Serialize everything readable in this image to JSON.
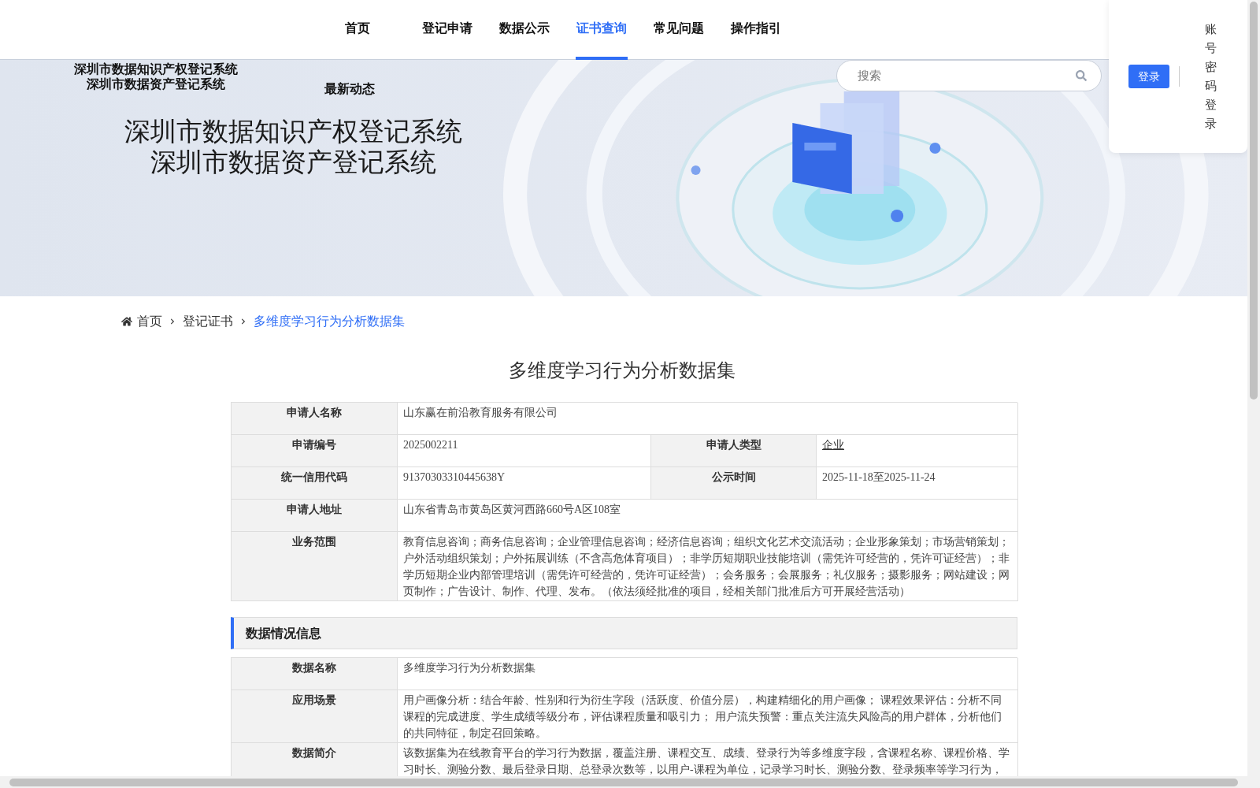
{
  "nav": [
    {
      "label": "首页",
      "selected": false
    },
    {
      "label": "登记申请",
      "selected": false
    },
    {
      "label": "数据公示",
      "selected": false
    },
    {
      "label": "证书查询",
      "selected": true
    },
    {
      "label": "常见问题",
      "selected": false
    },
    {
      "label": "操作指引",
      "selected": false
    }
  ],
  "header": {
    "small_titles": [
      "深圳市数据知识产权登记系统",
      "深圳市数据资产登记系统"
    ],
    "news": "最新动态",
    "search": {
      "placeholder": "搜索"
    }
  },
  "login": {
    "button": "登录",
    "password_login": "账号密码登录"
  },
  "banner": {
    "titles": [
      "深圳市数据知识产权登记系统",
      "深圳市数据资产登记系统"
    ]
  },
  "breadcrumb": [
    "首页",
    "登记证书",
    "多维度学习行为分析数据集"
  ],
  "page_title": "多维度学习行为分析数据集",
  "applicant_table": [
    [
      {
        "label": "申请人名称",
        "value": "山东赢在前沿教育服务有限公司"
      }
    ],
    [
      {
        "label": "申请编号",
        "value": "2025002211"
      },
      {
        "label": "申请人类型",
        "value": "企业",
        "link": true
      }
    ],
    [
      {
        "label": "统一信用代码",
        "value": "91370303310445638Y"
      },
      {
        "label": "公示时间",
        "value": "2025-11-18至2025-11-24"
      }
    ],
    [
      {
        "label": "申请人地址",
        "value": "山东省青岛市黄岛区黄河西路660号A区108室"
      }
    ],
    [
      {
        "label": "业务范围",
        "value": "教育信息咨询；商务信息咨询；企业管理信息咨询；经济信息咨询；组织文化艺术交流活动；企业形象策划；市场营销策划；户外活动组织策划；户外拓展训练（不含高危体育项目）；非学历短期职业技能培训（需凭许可经营的，凭许可证经营）；非学历短期企业内部管理培训（需凭许可经营的，凭许可证经营）；会务服务；会展服务；礼仪服务；摄影服务；网站建设；网页制作；广告设计、制作、代理、发布。（依法须经批准的项目，经相关部门批准后方可开展经营活动）"
      }
    ]
  ],
  "data_section": {
    "title": "数据情况信息",
    "rows": [
      {
        "label": "数据名称",
        "value": "多维度学习行为分析数据集"
      },
      {
        "label": "应用场景",
        "value": "用户画像分析：结合年龄、性别和行为衍生字段（活跃度、价值分层），构建精细化的用户画像； 课程效果评估：分析不同课程的完成进度、学生成绩等级分布，评估课程质量和吸引力； 用户流失预警：重点关注流失风险高的用户群体，分析他们的共同特征，制定召回策略。"
      },
      {
        "label": "数据简介",
        "value": "该数据集为在线教育平台的学习行为数据，覆盖注册、课程交互、成绩、登录行为等多维度字段，含课程名称、课程价格、学习时长、测验分数、最后登录日期、总登录次数等，以用户-课程为单位，记录学习时长、测验分数、登录频率等学习行为，"
      }
    ]
  }
}
